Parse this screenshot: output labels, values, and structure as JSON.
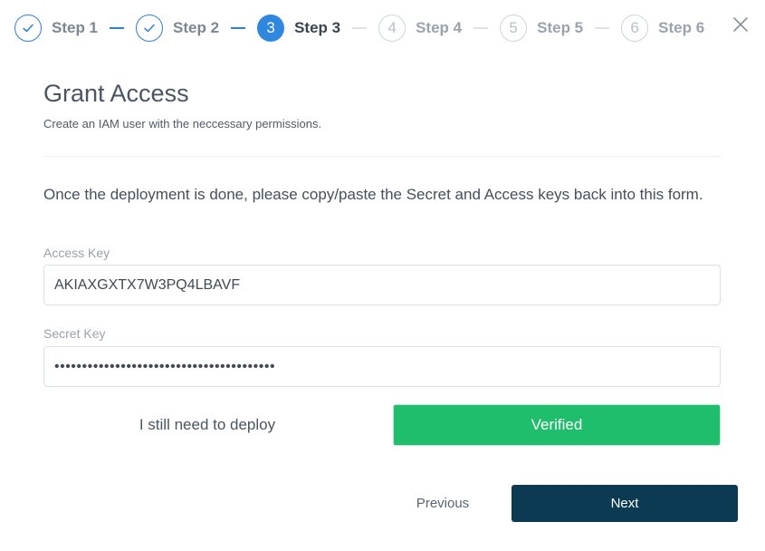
{
  "stepper": {
    "steps": [
      {
        "label": "Step 1",
        "number": "1",
        "state": "done"
      },
      {
        "label": "Step 2",
        "number": "2",
        "state": "done"
      },
      {
        "label": "Step 3",
        "number": "3",
        "state": "active"
      },
      {
        "label": "Step 4",
        "number": "4",
        "state": "todo"
      },
      {
        "label": "Step 5",
        "number": "5",
        "state": "todo"
      },
      {
        "label": "Step 6",
        "number": "6",
        "state": "todo"
      }
    ]
  },
  "header": {
    "title": "Grant Access",
    "subtitle": "Create an IAM user with the neccessary permissions."
  },
  "body": {
    "instructions": "Once the deployment is done, please copy/paste the Secret and Access keys back into this form."
  },
  "form": {
    "access_key_label": "Access Key",
    "access_key_value": "AKIAXGXTX7W3PQ4LBAVF",
    "secret_key_label": "Secret Key",
    "secret_key_value": "••••••••••••••••••••••••••••••••••••••••"
  },
  "actions": {
    "deploy_label": "I still need to deploy",
    "verified_label": "Verified",
    "previous_label": "Previous",
    "next_label": "Next"
  },
  "colors": {
    "step_done": "#2f7fd6",
    "step_active": "#2f87e0",
    "verified": "#1ebe6c",
    "next_button": "#0b3a52"
  },
  "icons": {
    "done_step": "check-icon",
    "close": "close-icon"
  }
}
